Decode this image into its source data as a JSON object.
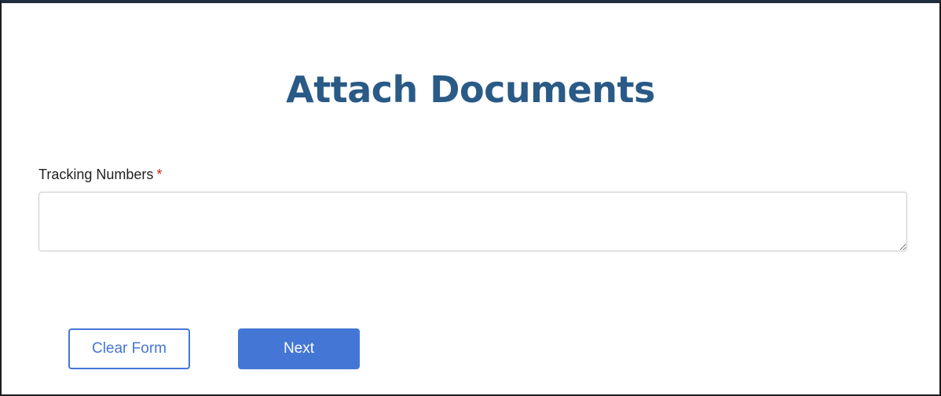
{
  "page": {
    "title": "Attach Documents"
  },
  "form": {
    "tracking_numbers": {
      "label": "Tracking Numbers",
      "required_marker": "*",
      "value": "",
      "placeholder": ""
    }
  },
  "actions": {
    "clear_label": "Clear Form",
    "next_label": "Next"
  },
  "colors": {
    "title": "#2a5a86",
    "accent": "#4476d6",
    "required": "#d0211c"
  }
}
